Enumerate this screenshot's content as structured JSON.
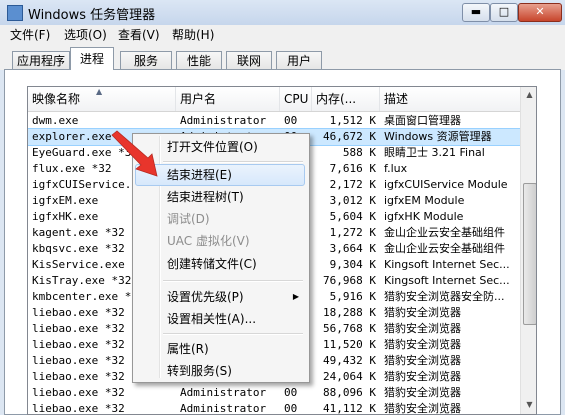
{
  "window": {
    "title": "Windows 任务管理器"
  },
  "window_controls": {
    "minimize": "▬",
    "maximize": "□",
    "close": "✕"
  },
  "menubar": [
    "文件(F)",
    "选项(O)",
    "查看(V)",
    "帮助(H)"
  ],
  "tabs": [
    "应用程序",
    "进程",
    "服务",
    "性能",
    "联网",
    "用户"
  ],
  "active_tab": "进程",
  "columns": [
    "映像名称",
    "用户名",
    "CPU",
    "内存(...",
    "描述"
  ],
  "rows": [
    {
      "name": "dwm.exe",
      "user": "Administrator",
      "cpu": "00",
      "mem": "1,512 K",
      "desc": "桌面窗口管理器"
    },
    {
      "name": "explorer.exe",
      "user": "Administrator",
      "cpu": "00",
      "mem": "46,672 K",
      "desc": "Windows 资源管理器"
    },
    {
      "name": "EyeGuard.exe *32",
      "user": "",
      "cpu": "",
      "mem": "588 K",
      "desc": "眼睛卫士 3.21 Final"
    },
    {
      "name": "flux.exe *32",
      "user": "",
      "cpu": "",
      "mem": "7,616 K",
      "desc": "f.lux"
    },
    {
      "name": "igfxCUIService.e",
      "user": "",
      "cpu": "",
      "mem": "2,172 K",
      "desc": "igfxCUIService Module"
    },
    {
      "name": "igfxEM.exe",
      "user": "",
      "cpu": "",
      "mem": "3,012 K",
      "desc": "igfxEM Module"
    },
    {
      "name": "igfxHK.exe",
      "user": "",
      "cpu": "",
      "mem": "5,604 K",
      "desc": "igfxHK Module"
    },
    {
      "name": "kagent.exe *32",
      "user": "",
      "cpu": "",
      "mem": "1,272 K",
      "desc": "金山企业云安全基础组件"
    },
    {
      "name": "kbqsvc.exe *32",
      "user": "",
      "cpu": "",
      "mem": "3,664 K",
      "desc": "金山企业云安全基础组件"
    },
    {
      "name": "KisService.exe *",
      "user": "",
      "cpu": "",
      "mem": "9,304 K",
      "desc": "Kingsoft Internet Sec..."
    },
    {
      "name": "KisTray.exe *32",
      "user": "",
      "cpu": "",
      "mem": "76,968 K",
      "desc": "Kingsoft Internet Sec..."
    },
    {
      "name": "kmbcenter.exe *3",
      "user": "",
      "cpu": "",
      "mem": "5,916 K",
      "desc": "猎豹安全浏览器安全防..."
    },
    {
      "name": "liebao.exe *32",
      "user": "",
      "cpu": "",
      "mem": "18,288 K",
      "desc": "猎豹安全浏览器"
    },
    {
      "name": "liebao.exe *32",
      "user": "",
      "cpu": "",
      "mem": "56,768 K",
      "desc": "猎豹安全浏览器"
    },
    {
      "name": "liebao.exe *32",
      "user": "",
      "cpu": "",
      "mem": "11,520 K",
      "desc": "猎豹安全浏览器"
    },
    {
      "name": "liebao.exe *32",
      "user": "",
      "cpu": "",
      "mem": "49,432 K",
      "desc": "猎豹安全浏览器"
    },
    {
      "name": "liebao.exe *32",
      "user": "",
      "cpu": "",
      "mem": "24,064 K",
      "desc": "猎豹安全浏览器"
    },
    {
      "name": "liebao.exe *32",
      "user": "Administrator",
      "cpu": "00",
      "mem": "88,096 K",
      "desc": "猎豹安全浏览器"
    },
    {
      "name": "liebao.exe *32",
      "user": "Administrator",
      "cpu": "00",
      "mem": "41,112 K",
      "desc": "猎豹安全浏览器"
    }
  ],
  "selected_row": "explorer.exe",
  "context_menu": [
    {
      "label": "打开文件位置(O)",
      "state": "normal"
    },
    {
      "label": "结束进程(E)",
      "state": "hover"
    },
    {
      "label": "结束进程树(T)",
      "state": "normal"
    },
    {
      "label": "调试(D)",
      "state": "disabled"
    },
    {
      "label": "UAC 虚拟化(V)",
      "state": "disabled"
    },
    {
      "label": "创建转储文件(C)",
      "state": "normal"
    },
    {
      "label": "设置优先级(P)",
      "state": "normal",
      "submenu": true
    },
    {
      "label": "设置相关性(A)...",
      "state": "normal"
    },
    {
      "label": "属性(R)",
      "state": "normal"
    },
    {
      "label": "转到服务(S)",
      "state": "normal"
    }
  ],
  "colors": {
    "selection": "#cce8ff",
    "annotation_arrow": "#e8352c",
    "title_bar": "#c6d6ec"
  },
  "icons": [
    "app-icon",
    "sort-up-arrow-icon",
    "scroll-up-icon",
    "scroll-down-icon",
    "submenu-arrow-icon",
    "red-annotation-arrow-icon"
  ]
}
